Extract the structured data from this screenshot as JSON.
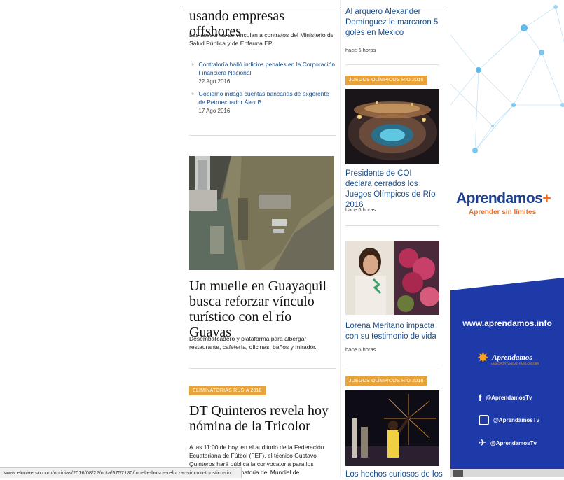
{
  "main": {
    "top_headline": "usando empresas offshores",
    "top_lead": "Las asesorías se vinculan a contratos del Ministerio de Salud Pública y de Enfarma EP.",
    "related": [
      {
        "title": "Contraloría halló indicios penales en la Corporación Financiera Nacional",
        "date": "22 Ago 2016"
      },
      {
        "title": "Gobierno indaga cuentas bancarias de exgerente de Petroecuador Álex B.",
        "date": "17 Ago 2016"
      }
    ],
    "story2": {
      "headline": "Un muelle en Guayaquil busca reforzar vínculo turístico con el río Guayas",
      "lead": "Desembarcadero y plataforma para albergar restaurante, cafetería, oficinas, baños y mirador."
    },
    "story3": {
      "tag": "ELIMINATORIAS RUSIA 2018",
      "headline": "DT Quinteros revela hoy nómina de la Tricolor",
      "lead": "A las 11:00 de hoy, en el auditorio de la Federación Ecuatoriana de Fútbol (FEF), el técnico Gustavo Quinteros hará pública la convocatoria para los partidos por la eliminatoria del Mundial de"
    }
  },
  "sidebar": {
    "items": [
      {
        "title": "Al arquero Alexander Domínguez le marcaron 5 goles en México",
        "time": "hace 5 horas"
      },
      {
        "tag": "JUEGOS OLÍMPICOS RÍO 2016",
        "title": "Presidente de COI declara cerrados los Juegos Olímpicos de Río 2016",
        "time": "hace 6 horas"
      },
      {
        "title": "Lorena Meritano impacta con su testimonio de vida",
        "time": "hace 6 horas"
      },
      {
        "tag": "JUEGOS OLÍMPICOS RÍO 2016",
        "title": "Los hechos curiosos de los"
      }
    ]
  },
  "ad": {
    "brand": "Aprendamos",
    "tagline": "Aprender sin límites",
    "url": "www.aprendamos.info",
    "brand2": "Aprendamos",
    "brand2_sub": "UNA OPORTUNIDAD PARA CRECER",
    "socials": [
      "@AprendamosTv",
      "@AprendamosTv",
      "@AprendamosTv"
    ],
    "colors": {
      "orange": "#f26a21",
      "blue": "#1d3aa8",
      "navy": "#1c3e8f"
    }
  },
  "status_bar": {
    "url": "www.eluniverso.com/noticias/2016/08/22/nota/5757180/muelle-busca-reforzar-vinculo-turistico-rio"
  }
}
